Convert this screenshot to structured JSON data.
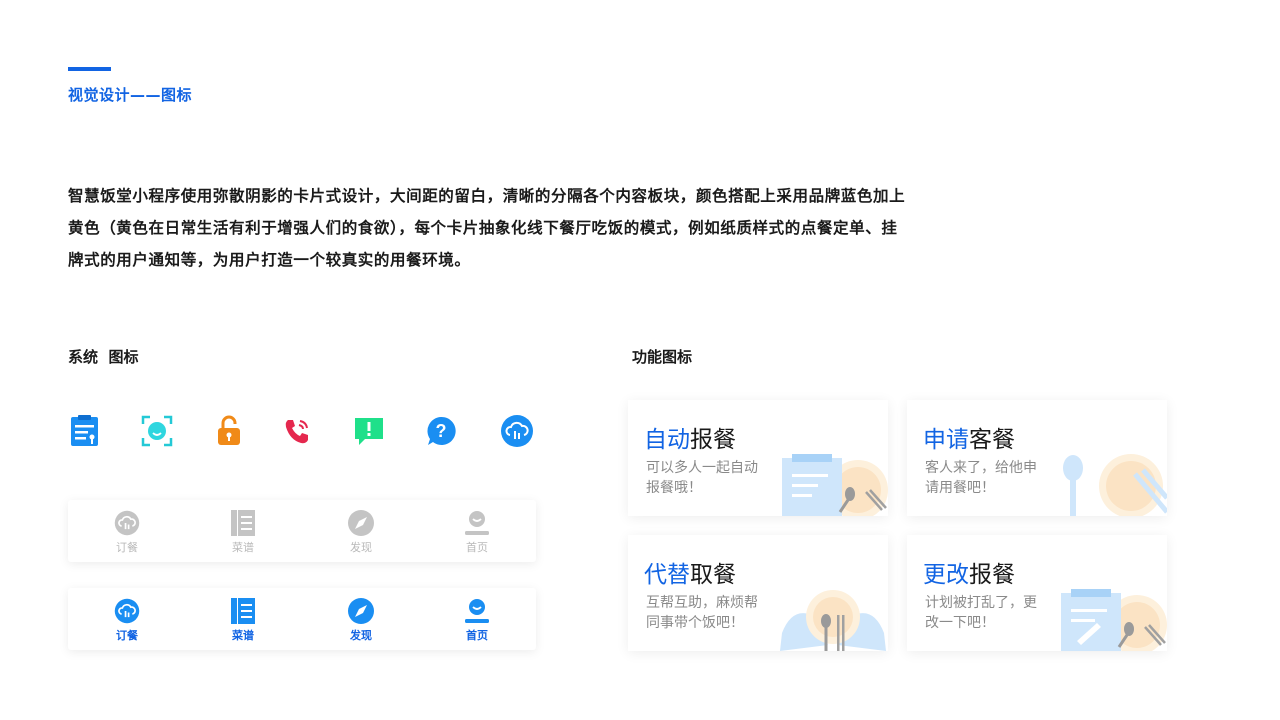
{
  "header": {
    "title": "视觉设计——图标"
  },
  "intro": {
    "lines": [
      "智慧饭堂小程序使用弥散阴影的卡片式设计，大间距的留白，清晰的分隔各个内容板块，颜色搭配上采用品牌蓝色加上",
      "黄色（黄色在日常生活有利于增强人们的食欲），每个卡片抽象化线下餐厅吃饭的模式，例如纸质样式的点餐定单、挂",
      "牌式的用户通知等，为用户打造一个较真实的用餐环境。"
    ]
  },
  "system_icons": {
    "heading": "系统  图标",
    "icons": [
      "clipboard-icon",
      "face-scan-icon",
      "unlock-icon",
      "phone-icon",
      "message-alert-icon",
      "help-icon",
      "cloud-icon"
    ]
  },
  "tabbar_inactive": {
    "tabs": [
      {
        "label": "订餐",
        "icon": "cloud-icon"
      },
      {
        "label": "菜谱",
        "icon": "menu-book-icon"
      },
      {
        "label": "发现",
        "icon": "compass-icon"
      },
      {
        "label": "首页",
        "icon": "home-user-icon"
      }
    ],
    "color": "#c4c4c4"
  },
  "tabbar_active": {
    "tabs": [
      {
        "label": "订餐",
        "icon": "cloud-icon"
      },
      {
        "label": "菜谱",
        "icon": "menu-book-icon"
      },
      {
        "label": "发现",
        "icon": "compass-icon"
      },
      {
        "label": "首页",
        "icon": "home-user-icon"
      }
    ],
    "color": "#1a8ef2"
  },
  "function_icons": {
    "heading": "功能图标",
    "cards": [
      {
        "title_highlight": "自动",
        "title_rest": "报餐",
        "desc_lines": [
          "可以多人一起自动",
          "报餐哦！"
        ]
      },
      {
        "title_highlight": "申请",
        "title_rest": "客餐",
        "desc_lines": [
          "客人来了，给他申",
          "请用餐吧！"
        ]
      },
      {
        "title_highlight": "代替",
        "title_rest": "取餐",
        "desc_lines": [
          "互帮互助，麻烦帮",
          "同事带个饭吧！"
        ]
      },
      {
        "title_highlight": "更改",
        "title_rest": "报餐",
        "desc_lines": [
          "计划被打乱了，更",
          "改一下吧！"
        ]
      }
    ]
  },
  "colors": {
    "brand_blue": "#1264e3",
    "light_blue": "#cfe6fb",
    "food_yellow": "#fbe3c4"
  }
}
